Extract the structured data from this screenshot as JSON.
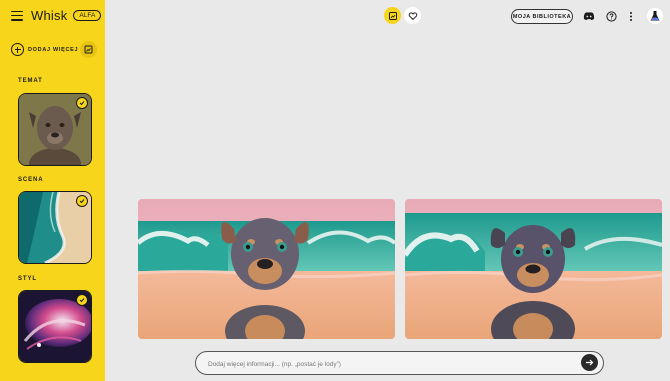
{
  "app": {
    "name": "Whisk",
    "badge": "ALFA"
  },
  "sidebar": {
    "add_more_label": "DODAJ WIĘCEJ",
    "sections": [
      {
        "label": "TEMAT",
        "image": "dog-portrait-thumbnail",
        "selected": true
      },
      {
        "label": "SCENA",
        "image": "beach-aerial-thumbnail",
        "selected": true
      },
      {
        "label": "STYL",
        "image": "abstract-art-thumbnail",
        "selected": true
      }
    ]
  },
  "topbar": {
    "library_label": "MOJA BIBLIOTEKA",
    "icons": [
      "images-icon",
      "heart-icon",
      "discord-icon",
      "help-icon",
      "more-vert-icon",
      "labs-flask-icon"
    ]
  },
  "results": [
    {
      "name": "generated-image-1"
    },
    {
      "name": "generated-image-2"
    }
  ],
  "prompt": {
    "placeholder": "Dodaj więcej informacji... (np. „postać je lody”)"
  },
  "colors": {
    "accent": "#f7d51a",
    "background": "#e9e9e9",
    "dark": "#1a1a1a"
  }
}
